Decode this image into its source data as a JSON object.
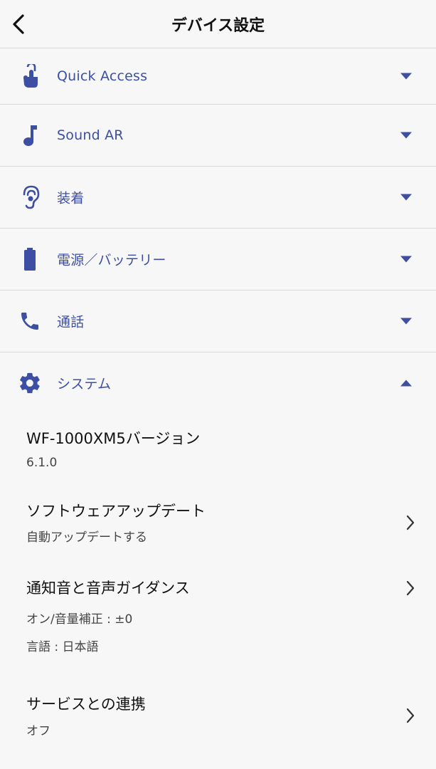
{
  "header": {
    "title": "デバイス設定",
    "back_icon": "chevron-left-icon"
  },
  "sections": [
    {
      "label": "Quick Access",
      "icon": "touch-icon",
      "expanded": false
    },
    {
      "label": "Sound AR",
      "icon": "music-note-icon",
      "expanded": false
    },
    {
      "label": "装着",
      "icon": "ear-icon",
      "expanded": false
    },
    {
      "label": "電源／バッテリー",
      "icon": "battery-icon",
      "expanded": false
    },
    {
      "label": "通話",
      "icon": "phone-icon",
      "expanded": false
    },
    {
      "label": "システム",
      "icon": "gear-icon",
      "expanded": true
    }
  ],
  "system_items": [
    {
      "title": "WF-1000XM5バージョン",
      "subs": [
        "6.1.0"
      ],
      "has_chevron": false
    },
    {
      "title": "ソフトウェアアップデート",
      "subs": [
        "自動アップデートする"
      ],
      "has_chevron": true
    },
    {
      "title": "通知音と音声ガイダンス",
      "subs": [
        "オン/音量補正 : ±0",
        "言語 : 日本語"
      ],
      "has_chevron": true
    },
    {
      "title": "サービスとの連携",
      "subs": [
        "オフ"
      ],
      "has_chevron": true
    }
  ],
  "colors": {
    "accent": "#3d4fa3",
    "background": "#f7f7f7",
    "divider": "#d9d9d9",
    "text": "#111111"
  }
}
